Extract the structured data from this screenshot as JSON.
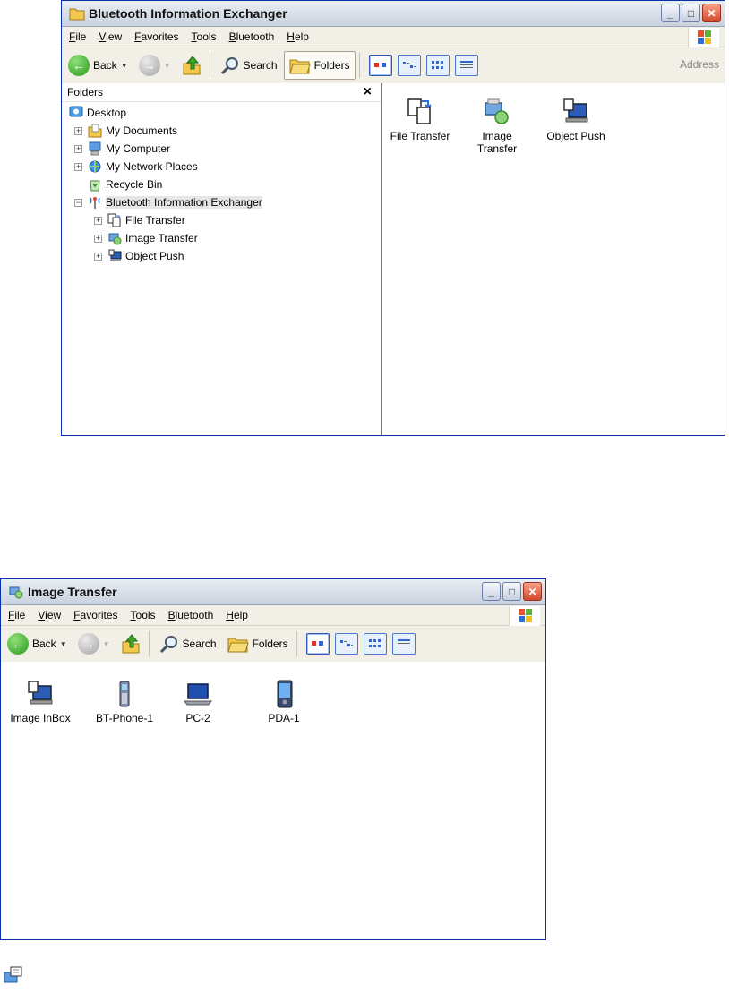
{
  "window1": {
    "title": "Bluetooth Information Exchanger",
    "menu": [
      "File",
      "View",
      "Favorites",
      "Tools",
      "Bluetooth",
      "Help"
    ],
    "toolbar": {
      "back": "Back",
      "search": "Search",
      "folders": "Folders",
      "address": "Address"
    },
    "folders_panel": {
      "title": "Folders",
      "close": "×",
      "tree": [
        {
          "label": "Desktop",
          "icon": "desktop-icon"
        },
        {
          "label": "My Documents",
          "icon": "my-documents-icon"
        },
        {
          "label": "My Computer",
          "icon": "my-computer-icon"
        },
        {
          "label": "My Network Places",
          "icon": "network-places-icon"
        },
        {
          "label": "Recycle Bin",
          "icon": "recycle-bin-icon"
        },
        {
          "label": "Bluetooth Information Exchanger",
          "icon": "bluetooth-exchanger-icon"
        },
        {
          "label": "File Transfer",
          "icon": "file-transfer-icon"
        },
        {
          "label": "Image Transfer",
          "icon": "image-transfer-icon"
        },
        {
          "label": "Object Push",
          "icon": "object-push-icon"
        }
      ]
    },
    "content_items": [
      {
        "label": "File Transfer",
        "icon": "file-transfer-icon"
      },
      {
        "label": "Image Transfer",
        "icon": "image-transfer-icon"
      },
      {
        "label": "Object Push",
        "icon": "object-push-icon"
      }
    ]
  },
  "window2": {
    "title": "Image Transfer",
    "menu": [
      "File",
      "View",
      "Favorites",
      "Tools",
      "Bluetooth",
      "Help"
    ],
    "toolbar": {
      "back": "Back",
      "search": "Search",
      "folders": "Folders"
    },
    "content_items": [
      {
        "label": "Image InBox",
        "icon": "image-inbox-icon"
      },
      {
        "label": "BT-Phone-1",
        "icon": "phone-icon"
      },
      {
        "label": "PC-2",
        "icon": "laptop-icon"
      },
      {
        "label": "PDA-1",
        "icon": "pda-icon"
      }
    ]
  },
  "colors": {
    "titlebar": "#d8dee8",
    "accent": "#0831a5",
    "close_button": "#d4472a"
  }
}
